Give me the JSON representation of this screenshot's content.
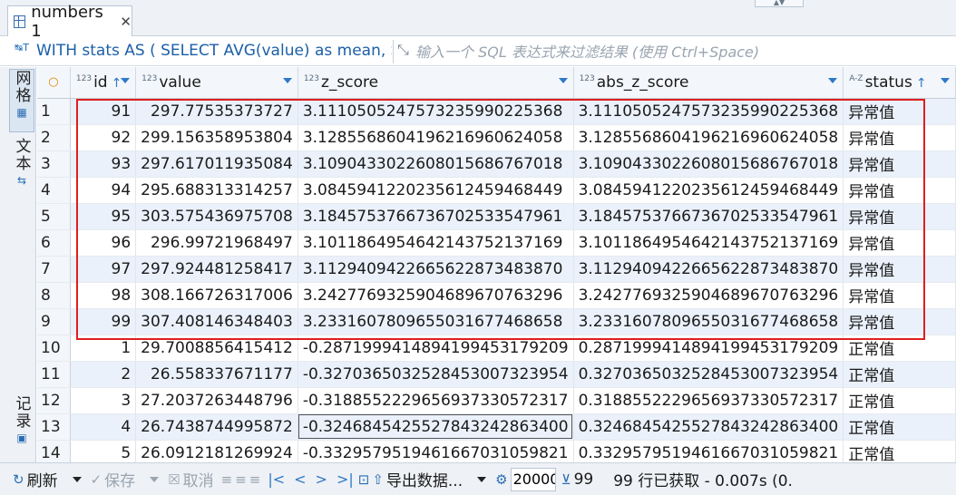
{
  "tab": {
    "title": "numbers 1",
    "close": "✕"
  },
  "filter": {
    "sql": "WITH stats AS ( SELECT AVG(value) as mean, STDDEV",
    "placeholder": "输入一个 SQL 表达式来过滤结果 (使用 Ctrl+Space)"
  },
  "sidebar": {
    "grid_label": "网格",
    "text_label": "文本",
    "record_label": "记录"
  },
  "columns": [
    {
      "type": "123",
      "label": "id",
      "sorted": "↑"
    },
    {
      "type": "123",
      "label": "value"
    },
    {
      "type": "123",
      "label": "z_score"
    },
    {
      "type": "123",
      "label": "abs_z_score"
    },
    {
      "type": "A-Z",
      "label": "status",
      "sorted": "↑"
    }
  ],
  "rows": [
    {
      "n": "1",
      "id": "91",
      "value": "297.77535373727",
      "z": "3.1110505247573235990225368",
      "az": "3.1110505247573235990225368",
      "status": "异常值"
    },
    {
      "n": "2",
      "id": "92",
      "value": "299.156358953804",
      "z": "3.1285568604196216960624058",
      "az": "3.1285568604196216960624058",
      "status": "异常值"
    },
    {
      "n": "3",
      "id": "93",
      "value": "297.617011935084",
      "z": "3.1090433022608015686767018",
      "az": "3.1090433022608015686767018",
      "status": "异常值"
    },
    {
      "n": "4",
      "id": "94",
      "value": "295.688313314257",
      "z": "3.0845941220235612459468449",
      "az": "3.0845941220235612459468449",
      "status": "异常值"
    },
    {
      "n": "5",
      "id": "95",
      "value": "303.575436975708",
      "z": "3.1845753766736702533547961",
      "az": "3.1845753766736702533547961",
      "status": "异常值"
    },
    {
      "n": "6",
      "id": "96",
      "value": "296.99721968497",
      "z": "3.1011864954642143752137169",
      "az": "3.1011864954642143752137169",
      "status": "异常值"
    },
    {
      "n": "7",
      "id": "97",
      "value": "297.924481258417",
      "z": "3.1129409422665622873483870",
      "az": "3.1129409422665622873483870",
      "status": "异常值"
    },
    {
      "n": "8",
      "id": "98",
      "value": "308.166726317006",
      "z": "3.2427769325904689670763296",
      "az": "3.2427769325904689670763296",
      "status": "异常值"
    },
    {
      "n": "9",
      "id": "99",
      "value": "307.408146348403",
      "z": "3.2331607809655031677468658",
      "az": "3.2331607809655031677468658",
      "status": "异常值"
    },
    {
      "n": "10",
      "id": "1",
      "value": "29.7008856415412",
      "z": "-0.2871999414894199453179209",
      "az": "0.2871999414894199453179209",
      "status": "正常值"
    },
    {
      "n": "11",
      "id": "2",
      "value": "26.558337671177",
      "z": "-0.3270365032528453007323954",
      "az": "0.3270365032528453007323954",
      "status": "正常值"
    },
    {
      "n": "12",
      "id": "3",
      "value": "27.2037263448796",
      "z": "-0.3188552229656937330572317",
      "az": "0.3188552229656937330572317",
      "status": "正常值"
    },
    {
      "n": "13",
      "id": "4",
      "value": "26.7438744995872",
      "z": "-0.3246845425527843242863400",
      "az": "0.3246845425527843242863400",
      "status": "正常值"
    },
    {
      "n": "14",
      "id": "5",
      "value": "26.0912181269924",
      "z": "-0.3329579519461667031059821",
      "az": "0.3329579519461667031059821",
      "status": "正常值"
    }
  ],
  "toolbar": {
    "refresh": "刷新",
    "save": "保存",
    "cancel": "取消",
    "export": "导出数据...",
    "fetch_size": "20000",
    "row_count": "99",
    "status": "99 行已获取 - 0.007s (0."
  }
}
